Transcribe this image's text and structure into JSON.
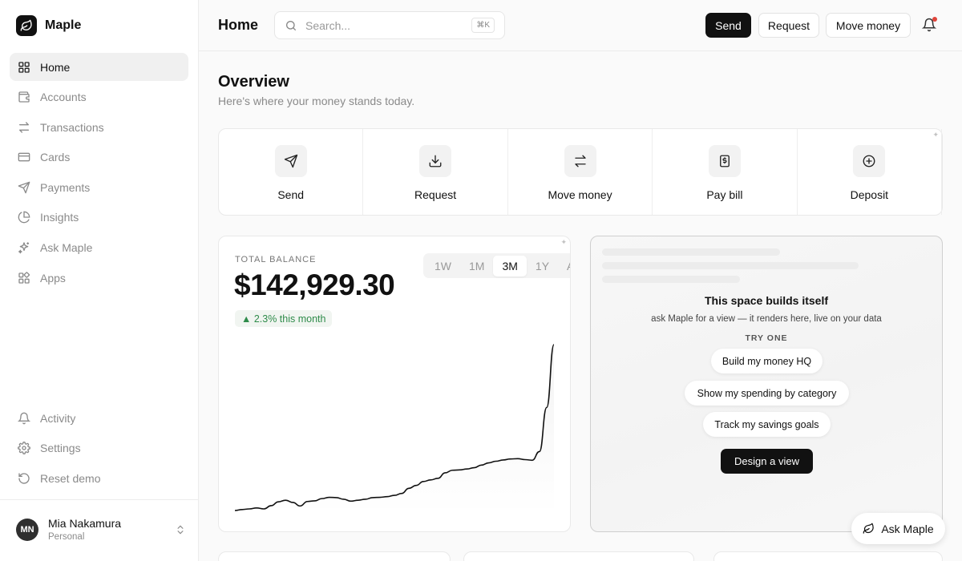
{
  "app": {
    "name": "Maple"
  },
  "sidebar": {
    "nav": [
      {
        "label": "Home",
        "icon": "grid-icon",
        "active": true
      },
      {
        "label": "Accounts",
        "icon": "wallet-icon"
      },
      {
        "label": "Transactions",
        "icon": "arrows-swap-icon"
      },
      {
        "label": "Cards",
        "icon": "credit-card-icon"
      },
      {
        "label": "Payments",
        "icon": "send-icon"
      },
      {
        "label": "Insights",
        "icon": "pie-chart-icon"
      },
      {
        "label": "Ask Maple",
        "icon": "sparkles-icon"
      },
      {
        "label": "Apps",
        "icon": "apps-icon"
      }
    ],
    "bottom": [
      {
        "label": "Activity",
        "icon": "bell-icon"
      },
      {
        "label": "Settings",
        "icon": "gear-icon"
      },
      {
        "label": "Reset demo",
        "icon": "reset-icon"
      }
    ],
    "user": {
      "initials": "MN",
      "name": "Mia Nakamura",
      "subtitle": "Personal"
    }
  },
  "header": {
    "title": "Home",
    "search": {
      "placeholder": "Search...",
      "shortcut": "⌘K"
    },
    "buttons": {
      "send": "Send",
      "request": "Request",
      "move_money": "Move money"
    },
    "notification_dot_color": "#e0443a"
  },
  "overview": {
    "title": "Overview",
    "subtitle": "Here's where your money stands today."
  },
  "quick_actions": [
    {
      "label": "Send",
      "icon": "send-icon"
    },
    {
      "label": "Request",
      "icon": "download-icon"
    },
    {
      "label": "Move money",
      "icon": "arrows-swap-icon"
    },
    {
      "label": "Pay bill",
      "icon": "receipt-icon"
    },
    {
      "label": "Deposit",
      "icon": "plus-circle-icon"
    }
  ],
  "balance": {
    "label": "TOTAL BALANCE",
    "amount": "$142,929.30",
    "change": "▲ 2.3% this month",
    "change_color": "#2e8b4a",
    "ranges": [
      "1W",
      "1M",
      "3M",
      "1Y",
      "All"
    ],
    "active_range": "3M"
  },
  "chart_data": {
    "type": "line",
    "series": [
      {
        "values": [
          0.0,
          0.03,
          0.05,
          0.08,
          0.05,
          0.15,
          0.27,
          0.32,
          0.25,
          0.14,
          0.28,
          0.3,
          0.37,
          0.41,
          0.4,
          0.35,
          0.29,
          0.32,
          0.35,
          0.4,
          0.41,
          0.43,
          0.47,
          0.53,
          0.69,
          0.78,
          0.9,
          0.95,
          1.0,
          1.17,
          1.25,
          1.26,
          1.29,
          1.33,
          1.41,
          1.48,
          1.53,
          1.57,
          1.6,
          1.61,
          1.58,
          1.56,
          1.83,
          3.2,
          5.15
        ]
      }
    ]
  },
  "empty_state": {
    "title": "This space builds itself",
    "subtitle": "ask Maple for a view — it renders here, live on your data",
    "try_label": "TRY ONE",
    "suggestions": [
      "Build my money HQ",
      "Show my spending by category",
      "Track my savings goals"
    ],
    "cta": "Design a view"
  },
  "assistant": {
    "label": "Ask Maple"
  }
}
